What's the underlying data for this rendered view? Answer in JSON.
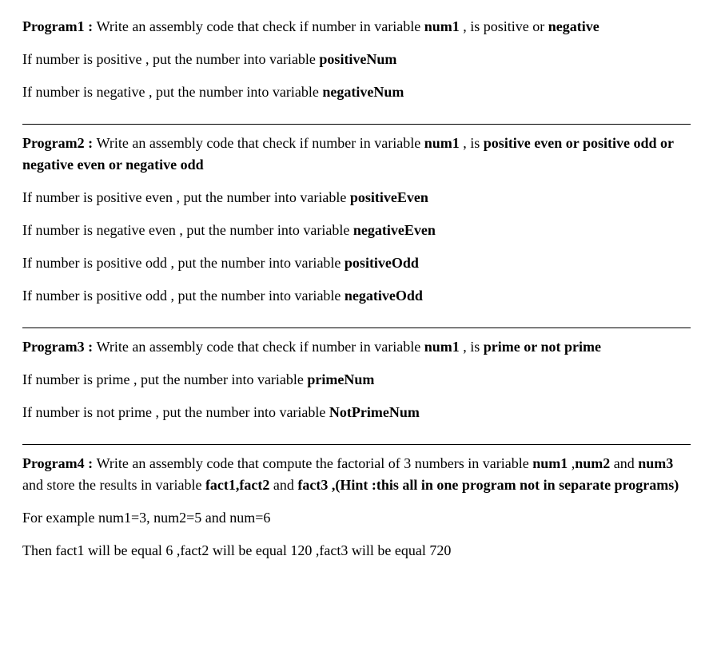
{
  "programs": [
    {
      "title_part1": "Program1 : ",
      "title_part2": "Write an assembly code that check if number in variable ",
      "title_bold1": "num1",
      "title_part3": " , is positive or ",
      "title_bold2": "negative",
      "lines": [
        {
          "prefix": "If number is positive , put the number into variable ",
          "bold": "positiveNum",
          "suffix": ""
        },
        {
          "prefix": "If number is negative , put the number into variable ",
          "bold": "negativeNum",
          "suffix": ""
        }
      ]
    },
    {
      "title_part1": "Program2 : ",
      "title_part2": "Write an assembly code that check if number in variable ",
      "title_bold1": "num1",
      "title_part3": " , is ",
      "title_bold2": "positive even or positive odd or negative even or negative odd",
      "lines": [
        {
          "prefix": "If number is positive even  , put the number into variable ",
          "bold": "positiveEven",
          "suffix": ""
        },
        {
          "prefix": "If number is negative even , put the number into variable ",
          "bold": "negativeEven",
          "suffix": ""
        },
        {
          "prefix": "If number is positive odd  , put the number into variable ",
          "bold": "positiveOdd",
          "suffix": ""
        },
        {
          "prefix": "If number is positive odd  , put the number into variable ",
          "bold": "negativeOdd",
          "suffix": ""
        }
      ]
    },
    {
      "title_part1": " Program3 : ",
      "title_part2": "Write an assembly code that check if number in variable ",
      "title_bold1": "num1",
      "title_part3": " , is ",
      "title_bold2": "prime or  not prime",
      "lines": [
        {
          "prefix": "If number is prime , put the number into variable ",
          "bold": "primeNum",
          "suffix": ""
        },
        {
          "prefix": "If number is not prime , put the number into variable ",
          "bold": "NotPrimeNum",
          "suffix": ""
        }
      ]
    }
  ],
  "program4": {
    "title_part1": "Program4 : ",
    "title_part2": "Write an assembly code that compute the factorial of 3 numbers in variable ",
    "title_bold1": "num1",
    "title_part3": " ,",
    "title_bold2": "num2",
    "title_part4": " and ",
    "title_bold3": "num3",
    "title_part5": " and store the results in variable ",
    "title_bold4": "fact1,fact2",
    "title_part6": " and ",
    "title_bold5": "fact3 ,(Hint :this all in one program not in separate programs)",
    "example_line": "For example num1=3, num2=5 and num=6",
    "result_line": "Then fact1 will be equal  6 ,fact2 will be equal 120  ,fact3 will be equal  720"
  }
}
